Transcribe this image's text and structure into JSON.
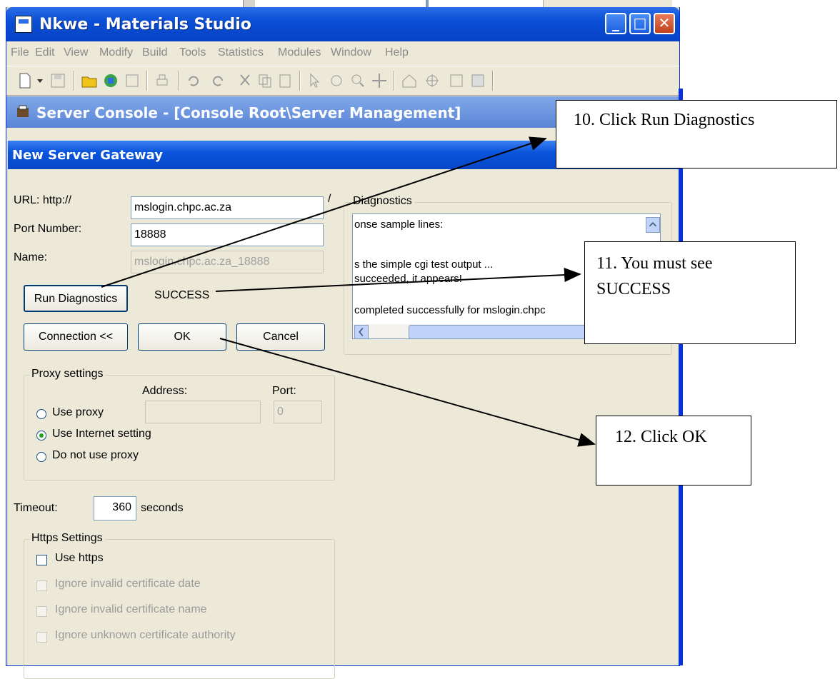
{
  "main_window": {
    "title": "Nkwe - Materials Studio",
    "menu": [
      "File",
      "Edit",
      "View",
      "Modify",
      "Build",
      "Tools",
      "Statistics",
      "Modules",
      "Window",
      "Help"
    ]
  },
  "server_console": {
    "title": "Server Console - [Console Root\\Server Management]"
  },
  "dialog": {
    "title": "New Server Gateway",
    "url_label": "URL:  http://",
    "url_value": "mslogin.chpc.ac.za",
    "url_slash": "/",
    "port_label": "Port Number:",
    "port_value": "18888",
    "name_label": "Name:",
    "name_value": "mslogin.chpc.ac.za_18888",
    "run_diagnostics_label": "Run Diagnostics",
    "status_text": "SUCCESS",
    "connection_label": "Connection <<",
    "ok_label": "OK",
    "cancel_label": "Cancel",
    "diagnostics": {
      "label": "Diagnostics",
      "lines": [
        "onse sample lines:",
        "",
        "s the simple cgi test output ...",
        "succeeded, it appears!",
        "",
        " completed successfully for mslogin.chpc"
      ]
    },
    "proxy": {
      "label": "Proxy settings",
      "address_label": "Address:",
      "port_label": "Port:",
      "port_value": "0",
      "options": [
        {
          "label": "Use proxy",
          "checked": false
        },
        {
          "label": "Use Internet setting",
          "checked": true
        },
        {
          "label": "Do not use proxy",
          "checked": false
        }
      ]
    },
    "timeout_label": "Timeout:",
    "timeout_value": "360",
    "timeout_unit": "seconds",
    "https": {
      "label": "Https Settings",
      "options": [
        {
          "label": "Use https",
          "enabled": true
        },
        {
          "label": "Ignore invalid certificate date",
          "enabled": false
        },
        {
          "label": "Ignore invalid certificate name",
          "enabled": false
        },
        {
          "label": "Ignore unknown certificate authority",
          "enabled": false
        }
      ]
    }
  },
  "callouts": {
    "step10": "10. Click Run Diagnostics",
    "step11_line1": "11. You must see",
    "step11_line2": "SUCCESS",
    "step12": "12. Click OK"
  },
  "colors": {
    "xp_title_blue": "#0a55dc",
    "dialog_bg": "#ece9d8",
    "close_red": "#d4502a"
  }
}
